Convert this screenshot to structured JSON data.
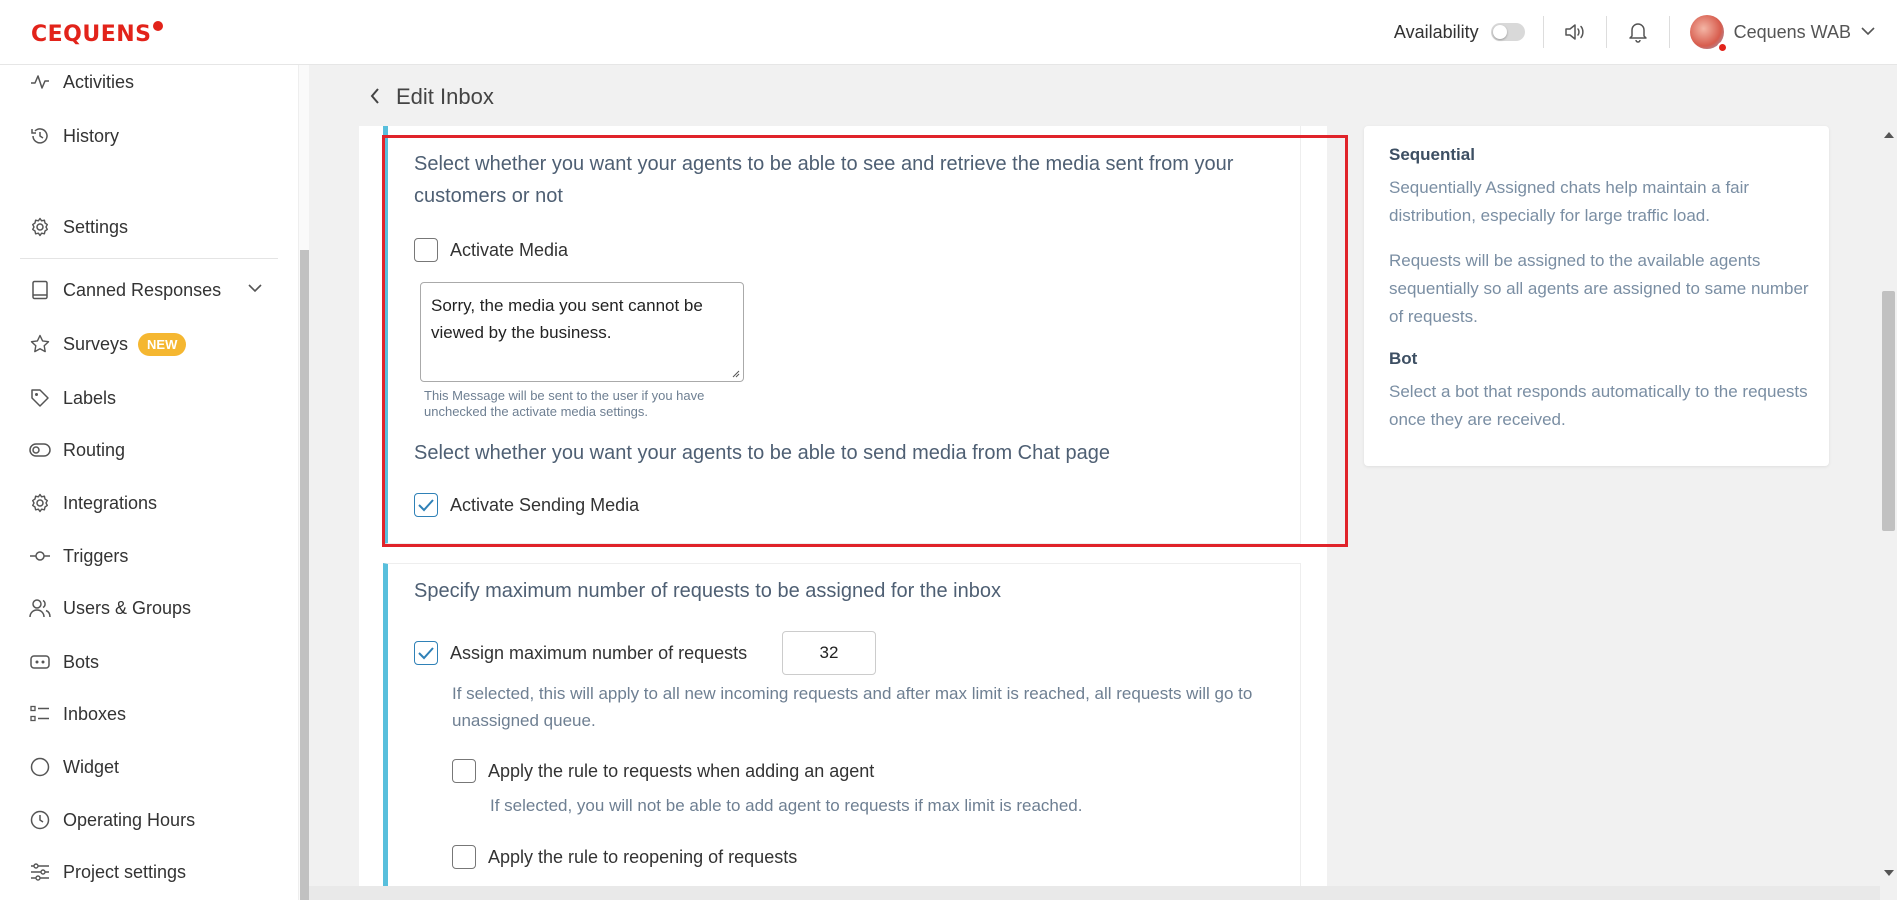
{
  "brand": {
    "logo_text": "CEQUENS",
    "accent": "#e2231a"
  },
  "topbar": {
    "availability_label": "Availability",
    "availability_on": false,
    "icons": [
      "speaker-icon",
      "bell-icon"
    ],
    "user_name": "Cequens WAB"
  },
  "sidebar": {
    "items": [
      {
        "label": "Activities",
        "icon": "activity-icon"
      },
      {
        "label": "History",
        "icon": "history-icon"
      },
      {
        "label": "Settings",
        "icon": "gear-icon"
      },
      {
        "label": "Canned Responses",
        "icon": "book-icon"
      },
      {
        "label": "Surveys",
        "icon": "star-icon",
        "badge": "NEW"
      },
      {
        "label": "Labels",
        "icon": "tag-icon"
      },
      {
        "label": "Routing",
        "icon": "routing-icon"
      },
      {
        "label": "Integrations",
        "icon": "gear-icon"
      },
      {
        "label": "Triggers",
        "icon": "trigger-icon"
      },
      {
        "label": "Users & Groups",
        "icon": "users-icon"
      },
      {
        "label": "Bots",
        "icon": "bot-icon"
      },
      {
        "label": "Inboxes",
        "icon": "list-icon"
      },
      {
        "label": "Widget",
        "icon": "circle-icon"
      },
      {
        "label": "Operating Hours",
        "icon": "clock-icon"
      },
      {
        "label": "Project settings",
        "icon": "sliders-icon"
      }
    ]
  },
  "page": {
    "title": "Edit Inbox"
  },
  "media_section": {
    "heading": "Select whether you want your agents to be able to see and retrieve the media sent from your customers or not",
    "activate_media_label": "Activate Media",
    "activate_media_checked": false,
    "message_value": "Sorry, the media you sent cannot be viewed by the business.",
    "message_hint": "This Message will be sent to the user if you have unchecked the activate media settings.",
    "send_heading": "Select whether you want your agents to be able to send media from Chat page",
    "activate_sending_label": "Activate Sending Media",
    "activate_sending_checked": true
  },
  "max_requests_section": {
    "heading": "Specify maximum number of requests to be assigned for the inbox",
    "assign_max_label": "Assign maximum number of requests",
    "assign_max_checked": true,
    "max_value": "32",
    "assign_max_desc": "If selected, this will apply to all new incoming requests and after max limit is reached, all requests will go to unassigned queue.",
    "rule_adding_label": "Apply the rule to requests when adding an agent",
    "rule_adding_checked": false,
    "rule_adding_desc": "If selected, you will not be able to add agent to requests if max limit is reached.",
    "rule_reopening_label": "Apply the rule to reopening of requests",
    "rule_reopening_checked": false
  },
  "info_panel": {
    "sequential_title": "Sequential",
    "sequential_text_1": "Sequentially Assigned chats help maintain a fair distribution, especially for large traffic load.",
    "sequential_text_2": "Requests will be assigned to the available agents sequentially so all agents are assigned to same number of requests.",
    "bot_title": "Bot",
    "bot_text": "Select a bot that responds automatically to the requests once they are received."
  },
  "colors": {
    "section_accent": "#58bfdc",
    "highlight_box": "#e0232a",
    "new_badge": "#f5b731",
    "checkbox_check": "#2f81b7"
  }
}
